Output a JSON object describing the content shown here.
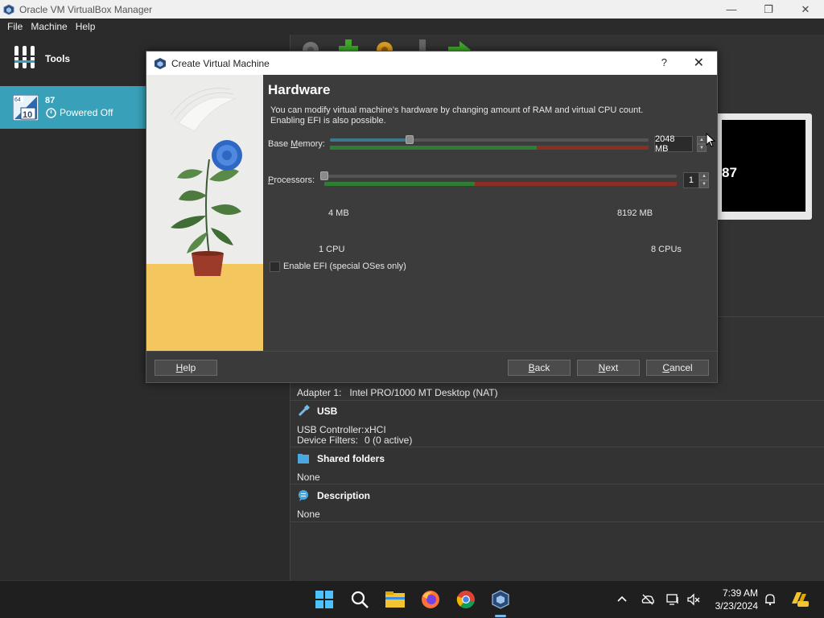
{
  "window": {
    "title": "Oracle VM VirtualBox Manager",
    "minimize": "—",
    "maximize": "❐",
    "close": "✕"
  },
  "menu": {
    "file": "File",
    "machine": "Machine",
    "help": "Help"
  },
  "sidebar": {
    "tools_label": "Tools",
    "vm": {
      "name": "87",
      "state": "Powered Off",
      "os_badge_top": "64",
      "os_badge_num": "10"
    }
  },
  "preview": {
    "vm_name": "87"
  },
  "details": {
    "adapter_key": "Adapter 1:",
    "adapter_value": "Intel PRO/1000 MT Desktop (NAT)",
    "usb_heading": "USB",
    "usb_controller_key": "USB Controller:",
    "usb_controller_value": "xHCI",
    "device_filters_key": "Device Filters:",
    "device_filters_value": "0 (0 active)",
    "shared_heading": "Shared folders",
    "shared_value": "None",
    "description_heading": "Description",
    "description_value": "None"
  },
  "dialog": {
    "title": "Create Virtual Machine",
    "help_glyph": "?",
    "close_glyph": "✕",
    "heading": "Hardware",
    "description_line1": "You can modify virtual machine's hardware by changing amount of RAM and virtual CPU count.",
    "description_line2": "Enabling EFI is also possible.",
    "memory": {
      "label_prefix": "Base ",
      "label_accel": "M",
      "label_suffix": "emory:",
      "value": "2048 MB",
      "min_label": "4 MB",
      "max_label": "8192 MB",
      "min": 4,
      "max": 8192,
      "current": 2048
    },
    "processors": {
      "label_accel": "P",
      "label_suffix": "rocessors:",
      "value": "1",
      "min_label": "1 CPU",
      "max_label": "8 CPUs",
      "min": 1,
      "max": 8,
      "current": 1
    },
    "efi": {
      "label": "Enable EFI (special OSes only)",
      "checked": false
    },
    "buttons": {
      "help_accel": "H",
      "help_rest": "elp",
      "back_accel": "B",
      "back_rest": "ack",
      "next_accel": "N",
      "next_rest": "ext",
      "cancel_accel": "C",
      "cancel_rest": "ancel"
    }
  },
  "taskbar": {
    "apps": [
      "start-icon",
      "search-icon",
      "file-explorer-icon",
      "firefox-icon",
      "chrome-icon",
      "virtualbox-icon"
    ],
    "clock_time": "7:39 AM",
    "clock_date": "3/23/2024"
  },
  "colors": {
    "accent_selected": "#38a0b8",
    "memory_green": "#2e7d32",
    "memory_red": "#8b2e23"
  }
}
